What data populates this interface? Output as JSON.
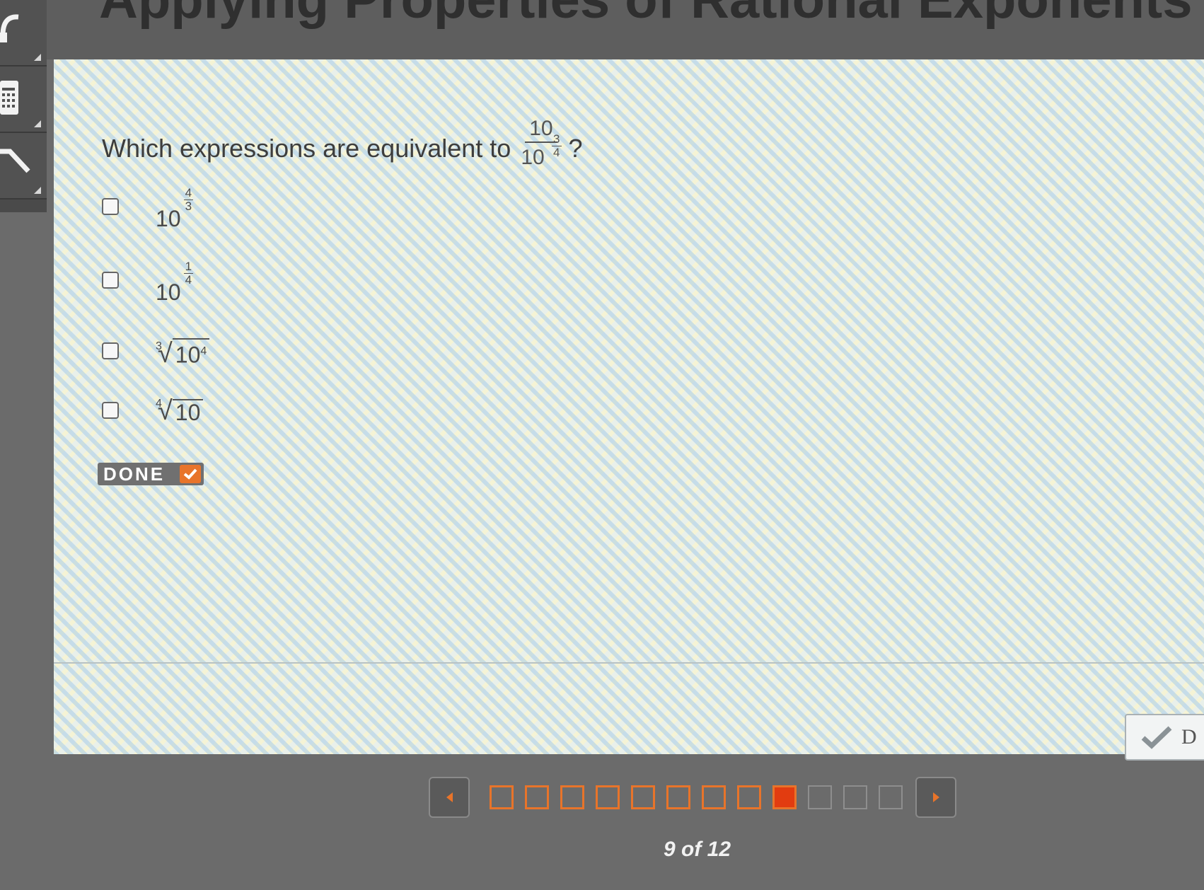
{
  "header": {
    "title": "Applying Properties of Rational Exponents"
  },
  "question": {
    "prompt": "Which expressions are equivalent to",
    "fraction": {
      "numerator": "10",
      "denominator_base": "10",
      "denominator_exp_num": "3",
      "denominator_exp_den": "4"
    },
    "end": "?"
  },
  "options": [
    {
      "base": "10",
      "exp_num": "4",
      "exp_den": "3"
    },
    {
      "base": "10",
      "exp_num": "1",
      "exp_den": "4"
    },
    {
      "index": "3",
      "radicand_base": "10",
      "radicand_exp": "4"
    },
    {
      "index": "4",
      "radicand": "10"
    }
  ],
  "done_button": {
    "label": "DONE"
  },
  "submit_button": {
    "label": "D"
  },
  "pager": {
    "status": "9 of 12",
    "total": 12,
    "current": 9
  },
  "colors": {
    "accent": "#e8742a",
    "current": "#e23c10"
  }
}
